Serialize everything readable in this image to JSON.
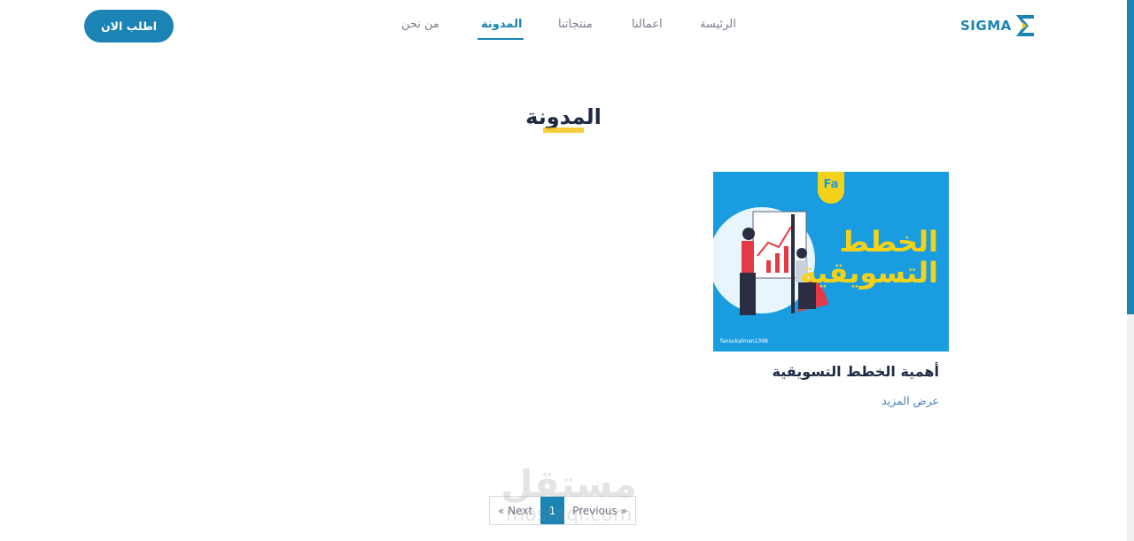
{
  "header": {
    "logo_text": "SIGMA",
    "nav": {
      "home": "الرئيسة",
      "works": "اعمالنا",
      "products": "منتجاتنا",
      "blog": "المدونة",
      "about": "من نحن"
    },
    "active_nav": "blog",
    "cta_label": "اطلب الان"
  },
  "page": {
    "title": "المدونة"
  },
  "posts": [
    {
      "image_title_line1": "الخطط",
      "image_title_line2": "التسويقية",
      "image_badge": "Fa",
      "image_handle": "fansukalman1398",
      "title": "أهمية الخطط التسويقية",
      "more_label": "عرض المزيد"
    }
  ],
  "pagination": {
    "next": "« Next",
    "current": "1",
    "previous": "Previous »"
  },
  "watermark": {
    "arabic": "مستقل",
    "latin": "mostaql.com"
  },
  "colors": {
    "brand": "#1c84b4",
    "heading": "#1f2a44",
    "accent_yellow": "#f5c518",
    "image_bg": "#1a9de0"
  }
}
